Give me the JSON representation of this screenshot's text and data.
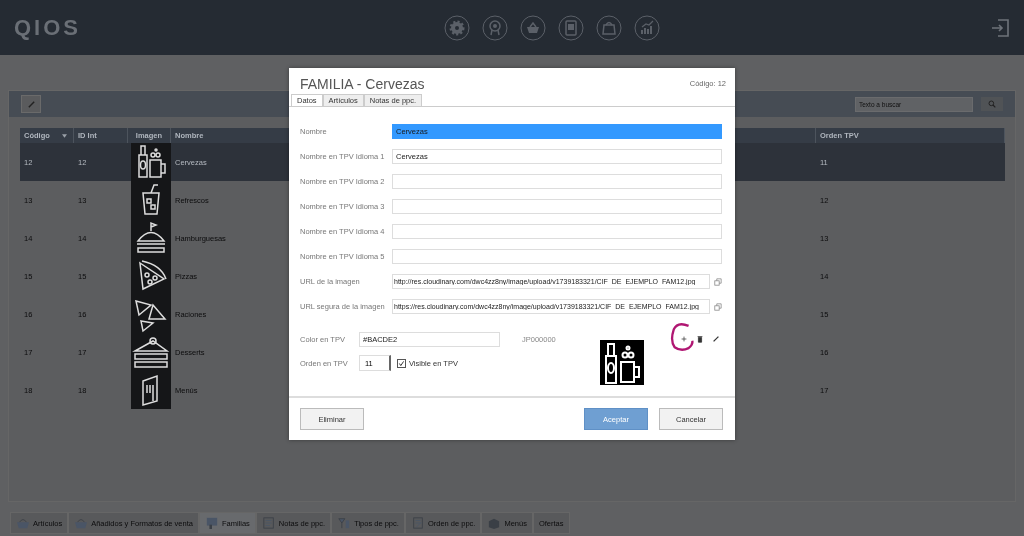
{
  "header": {
    "logo": "QIOS"
  },
  "toolbar": {
    "search": {
      "placeholder": "Texto a buscar"
    }
  },
  "table": {
    "columns": [
      {
        "label": "Código",
        "sorted": true
      },
      {
        "label": "ID Int",
        "sorted": false
      },
      {
        "label": "Imagen",
        "sorted": false
      },
      {
        "label": "Nombre",
        "sorted": false
      },
      {
        "label": "Orden TPV",
        "sorted": false
      }
    ],
    "rows": [
      {
        "codigo": "12",
        "id_int": "12",
        "nombre": "Cervezas",
        "orden_tpv": "11",
        "selected": true
      },
      {
        "codigo": "13",
        "id_int": "13",
        "nombre": "Refrescos",
        "orden_tpv": "12",
        "selected": false
      },
      {
        "codigo": "14",
        "id_int": "14",
        "nombre": "Hamburguesas",
        "orden_tpv": "13",
        "selected": false
      },
      {
        "codigo": "15",
        "id_int": "15",
        "nombre": "Pizzas",
        "orden_tpv": "14",
        "selected": false
      },
      {
        "codigo": "16",
        "id_int": "16",
        "nombre": "Raciones",
        "orden_tpv": "15",
        "selected": false
      },
      {
        "codigo": "17",
        "id_int": "17",
        "nombre": "Desserts",
        "orden_tpv": "16",
        "selected": false
      },
      {
        "codigo": "18",
        "id_int": "18",
        "nombre": "Menús",
        "orden_tpv": "17",
        "selected": false
      }
    ]
  },
  "dialog": {
    "title": "FAMILIA - Cervezas",
    "code": "Código: 12",
    "tabs": [
      {
        "label": "Datos",
        "selected": true
      },
      {
        "label": "Artículos",
        "selected": false
      },
      {
        "label": "Notas de ppc.",
        "selected": false
      }
    ],
    "fields": [
      {
        "label": "Nombre",
        "value": "Cervezas",
        "highlighted": true
      },
      {
        "label": "Nombre en TPV Idioma 1",
        "value": "Cervezas",
        "highlighted": false
      },
      {
        "label": "Nombre en TPV Idioma 2",
        "highlighted": false
      },
      {
        "label": "Nombre en TPV Idioma 3",
        "highlighted": false
      },
      {
        "label": "Nombre en TPV Idioma 4",
        "highlighted": false
      },
      {
        "label": "Nombre en TPV Idioma 5",
        "highlighted": false
      }
    ],
    "url_fields": [
      {
        "label": "URL de la imagen",
        "value": "http://res.cloudinary.com/dwc4zz8ny/image/upload/v1739183321/CIF_DE_EJEMPLO_FAM12.jpg"
      },
      {
        "label": "URL segura de la imagen",
        "value": "https://res.cloudinary.com/dwc4zz8ny/image/upload/v1739183321/CIF_DE_EJEMPLO_FAM12.jpg"
      }
    ],
    "color": {
      "label": "Color en TPV",
      "value": "#BACDE2",
      "code": "JP000000"
    },
    "order": {
      "label": "Orden en TPV",
      "value": "11"
    },
    "visible": {
      "label": "Visible en TPV",
      "checked": true
    },
    "buttons": {
      "delete": "Eliminar",
      "accept": "Aceptar",
      "cancel": "Cancelar"
    }
  },
  "bottom_tabs": [
    {
      "label": "Artículos",
      "selected": false
    },
    {
      "label": "Añadidos y Formatos de venta",
      "selected": false
    },
    {
      "label": "Familias",
      "selected": true
    },
    {
      "label": "Notas de ppc.",
      "selected": false
    },
    {
      "label": "Tipos de ppc.",
      "selected": false
    },
    {
      "label": "Orden de ppc.",
      "selected": false
    },
    {
      "label": "Menús",
      "selected": false
    },
    {
      "label": "Ofertas",
      "selected": false
    }
  ]
}
